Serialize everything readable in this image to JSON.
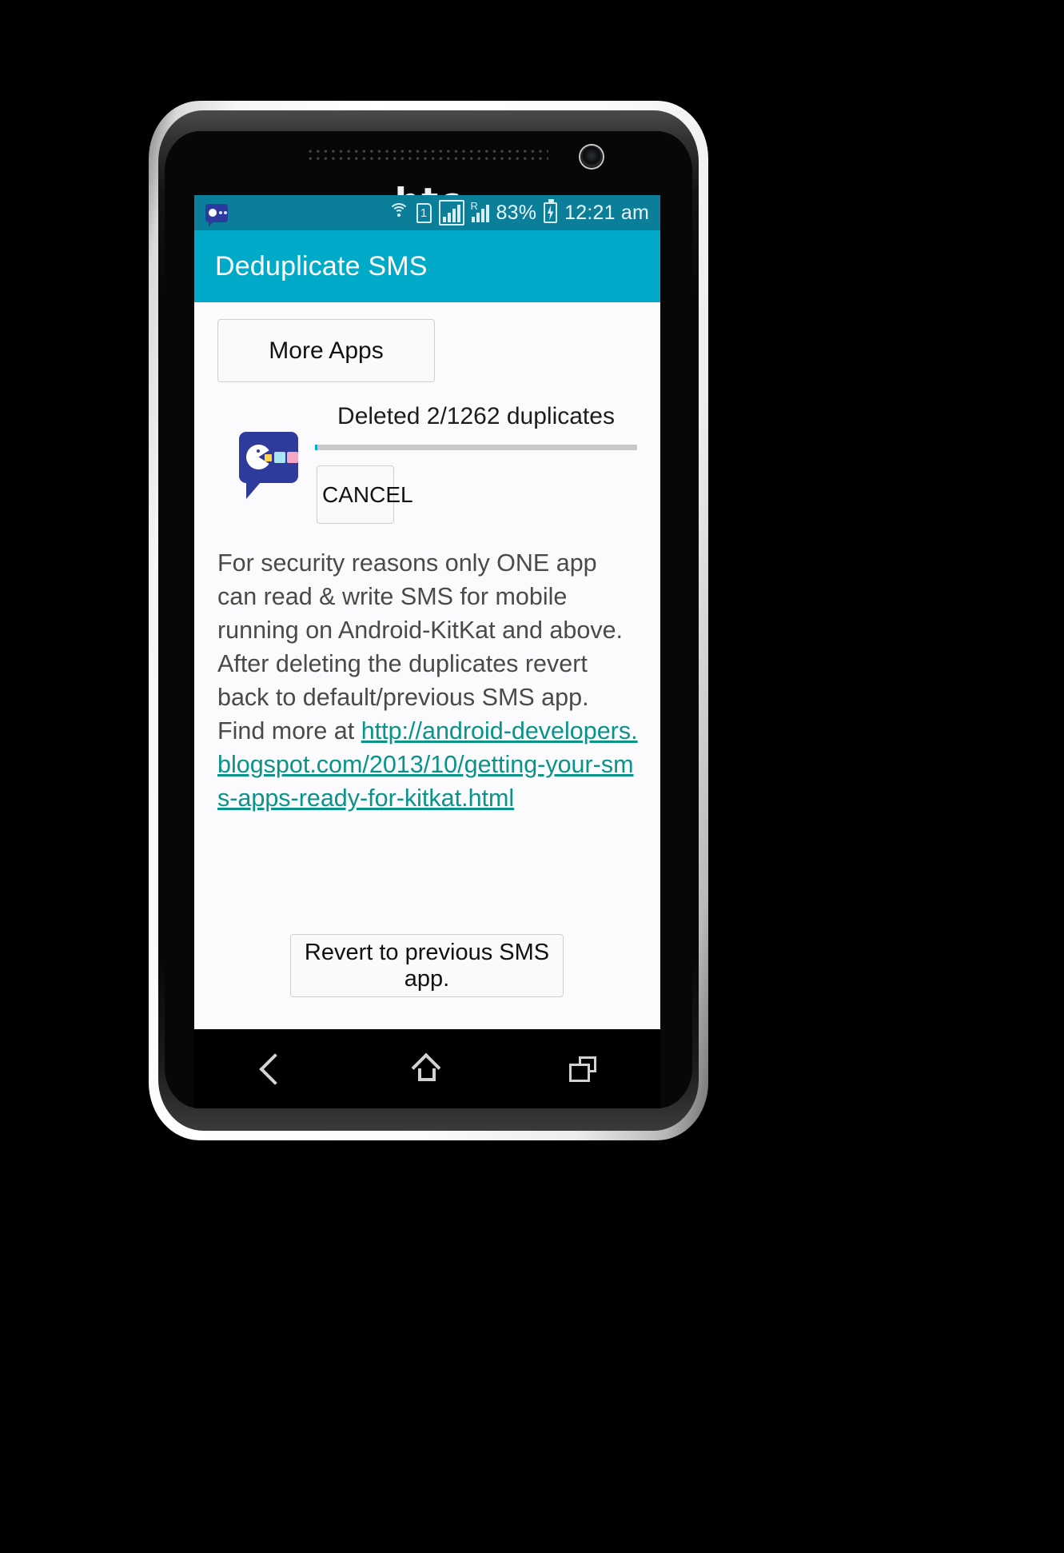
{
  "device": {
    "brand_logo": "htc",
    "hardware": {
      "speaker_grille": "speaker-grille",
      "front_camera": "front-camera-icon"
    }
  },
  "status_bar": {
    "notification_icon": "sms-bubble-icon",
    "icons": [
      "wifi-icon",
      "sim-1-icon",
      "signal-bars-icon",
      "roaming-signal-icon"
    ],
    "sim_label": "1",
    "roaming_label": "R",
    "battery_percent": "83%",
    "battery_icon": "battery-charging-icon",
    "time": "12:21 am",
    "background_color": "#0b7e99"
  },
  "app_bar": {
    "title": "Deduplicate SMS",
    "background_color": "#00aac8"
  },
  "content": {
    "more_apps_label": "More Apps",
    "progress": {
      "app_icon": "deduplicate-sms-app-icon",
      "label": "Deleted 2/1262 duplicates",
      "deleted": 2,
      "total": 1262,
      "percent": 0.16,
      "fill_color": "#00aac8",
      "track_color": "#c8c8c8",
      "cancel_label": "CANCEL"
    },
    "info_text_before_link": "For security reasons only ONE app can read & write SMS for mobile running on Android-KitKat and above. After deleting the duplicates revert back to default/previous SMS app. Find more at ",
    "info_link_text": "http://android-developers.blogspot.com/2013/10/getting-your-sms-apps-ready-for-kitkat.html",
    "link_color": "#0a9389",
    "revert_label": "Revert to previous SMS app."
  },
  "nav_bar": {
    "back_icon": "back-icon",
    "home_icon": "home-icon",
    "recents_icon": "recents-icon"
  }
}
